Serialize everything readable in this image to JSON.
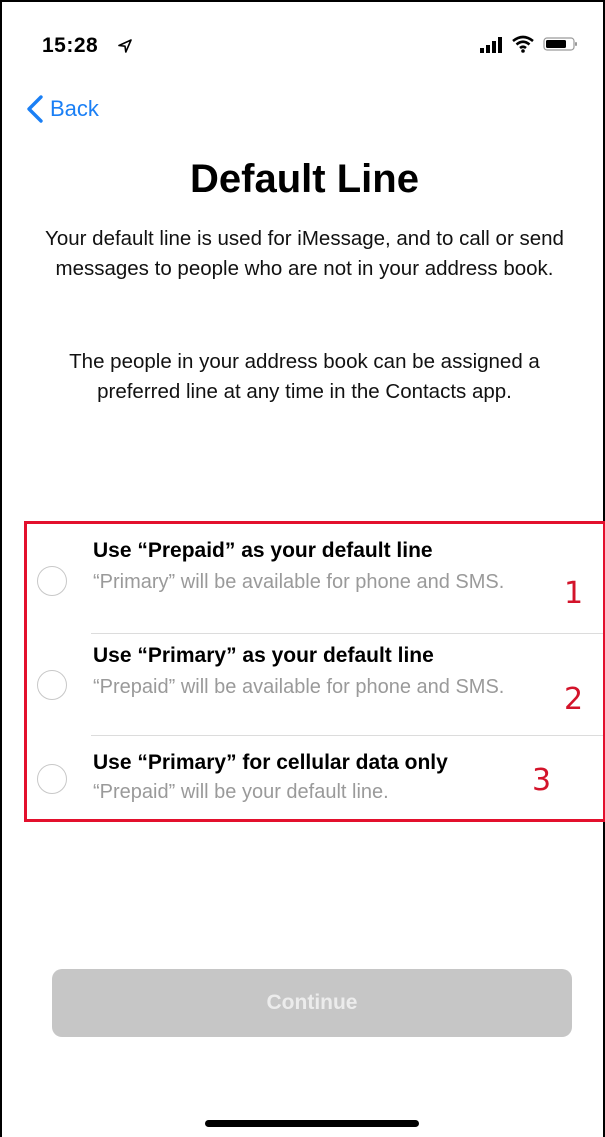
{
  "status_bar": {
    "time": "15:28",
    "icons": [
      "location-arrow-icon",
      "signal-icon",
      "wifi-icon",
      "battery-icon"
    ]
  },
  "nav": {
    "back_label": "Back",
    "back_icon": "chevron-left-icon"
  },
  "page": {
    "title": "Default Line",
    "description_1": "Your default line is used for iMessage, and to call or send messages to people who are not in your address book.",
    "description_2": "The people in your address book can be assigned a preferred line at any time in the Contacts app."
  },
  "options": [
    {
      "title": "Use “Prepaid” as your default line",
      "subtitle": "“Primary” will be available for phone and SMS.",
      "annotation": "1",
      "selected": false
    },
    {
      "title": "Use “Primary” as your default line",
      "subtitle": "“Prepaid” will be available for phone and SMS.",
      "annotation": "2",
      "selected": false
    },
    {
      "title": "Use “Primary” for cellular data only",
      "subtitle": "“Prepaid” will be your default line.",
      "annotation": "3",
      "selected": false
    }
  ],
  "continue_button": {
    "label": "Continue",
    "enabled": false
  },
  "colors": {
    "accent": "#1a7ff5",
    "annotation": "#e3102d",
    "disabled_button": "#c6c6c6",
    "secondary_text": "#9a9a9a"
  }
}
